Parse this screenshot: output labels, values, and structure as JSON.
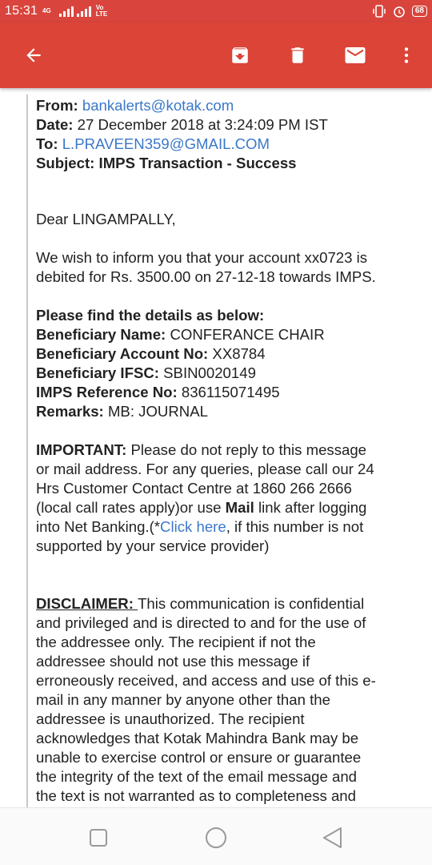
{
  "status_bar": {
    "time": "15:31",
    "net_label_top": "4G",
    "volte_top": "Vo",
    "volte_bottom": "LTE",
    "battery": "68"
  },
  "app_bar": {
    "icons": [
      "arrow-back-icon",
      "archive-icon",
      "delete-icon",
      "mail-icon",
      "more-vert-icon"
    ],
    "background": "#db4437"
  },
  "email": {
    "from_label": "From:",
    "from_value": "bankalerts@kotak.com",
    "date_label": "Date:",
    "date_value": "27 December 2018 at 3:24:09 PM IST",
    "to_label": "To:",
    "to_value": "L.PRAVEEN359@GMAIL.COM",
    "subject_label": "Subject:",
    "subject_value": "IMPS Transaction - Success",
    "greeting": "Dear LINGAMPALLY,",
    "intro_line1": "We wish to inform you that your account xx0723 is",
    "intro_line2": "debited for Rs. 3500.00 on 27-12-18 towards IMPS.",
    "details_heading": "Please find the details as below:",
    "beneficiary_name_label": "Beneficiary Name:",
    "beneficiary_name_value": "CONFERANCE CHAIR",
    "beneficiary_account_label": "Beneficiary Account No:",
    "beneficiary_account_value": "XX8784",
    "beneficiary_ifsc_label": "Beneficiary IFSC:",
    "beneficiary_ifsc_value": "SBIN0020149",
    "imps_ref_label": "IMPS Reference No:",
    "imps_ref_value": "836115071495",
    "remarks_label": "Remarks:",
    "remarks_value": "MB: JOURNAL",
    "important_label": "IMPORTANT:",
    "important_line1": "Please do not reply to this message",
    "important_line2": "or mail address. For any queries, please call our 24",
    "important_line3": "Hrs Customer Contact Centre at 1860 266 2666",
    "important_line4a": "(local call rates apply)or use ",
    "important_line4_mail": "Mail",
    "important_line4b": " link after logging",
    "important_line5a": "into Net Banking.(*",
    "important_line5_link": "Click here",
    "important_line5b": ", if this number is not",
    "important_line6": "supported by your service provider)",
    "disclaimer_label": "DISCLAIMER: ",
    "disclaimer_line1": "This communication is confidential",
    "disclaimer_line2": "and privileged and is directed to and for the use of",
    "disclaimer_line3": "the addressee only. The recipient if not the",
    "disclaimer_line4": "addressee should not use this message if",
    "disclaimer_line5": "erroneously received, and access and use of this e-",
    "disclaimer_line6": "mail in any manner by anyone other than the",
    "disclaimer_line7": "addressee is unauthorized. The recipient",
    "disclaimer_line8": "acknowledges that Kotak Mahindra Bank may be",
    "disclaimer_line9": "unable to exercise control or ensure or guarantee",
    "disclaimer_line10": "the integrity of the text of the email message and",
    "disclaimer_line11": "the text is not warranted as to completeness and"
  },
  "colors": {
    "accent": "#db4437",
    "link": "#3b78c9"
  }
}
